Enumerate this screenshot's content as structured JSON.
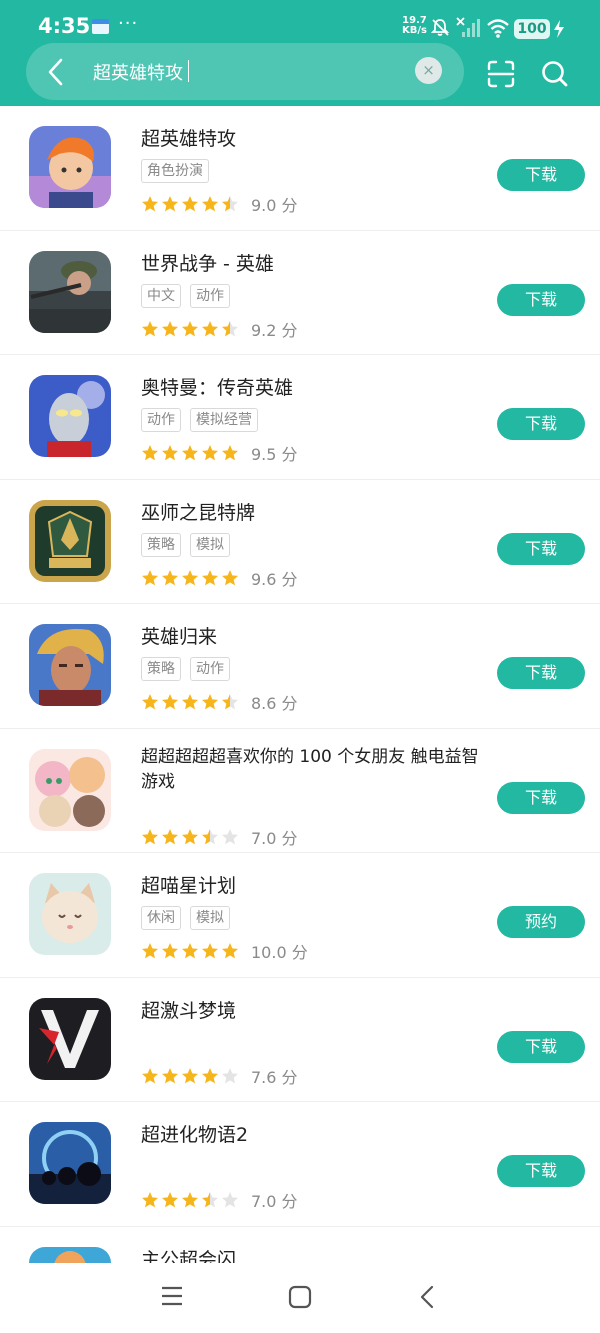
{
  "status_bar": {
    "time": "4:35",
    "net_speed_value": "19.7",
    "net_speed_unit": "KB/s",
    "battery": "100",
    "icons": [
      "app-card-icon",
      "more-dots-icon",
      "mute-icon",
      "no-signal-icon",
      "wifi-icon",
      "battery-icon",
      "charging-icon"
    ]
  },
  "search": {
    "query": "超英雄特攻",
    "clear_symbol": "×",
    "icons": [
      "back-arrow-icon",
      "clear-icon",
      "scan-icon",
      "search-icon"
    ]
  },
  "colors": {
    "brand": "#22b8a1",
    "star": "#f7b51c",
    "star_empty": "#e4e4e4"
  },
  "results": [
    {
      "title": "超英雄特攻",
      "tags": [
        "角色扮演"
      ],
      "rating": 4.5,
      "score": "9.0 分",
      "action": "下载"
    },
    {
      "title": "世界战争 - 英雄",
      "tags": [
        "中文",
        "动作"
      ],
      "rating": 4.5,
      "score": "9.2 分",
      "action": "下载"
    },
    {
      "title": "奥特曼：传奇英雄",
      "tags": [
        "动作",
        "模拟经营"
      ],
      "rating": 5,
      "score": "9.5 分",
      "action": "下载"
    },
    {
      "title": "巫师之昆特牌",
      "tags": [
        "策略",
        "模拟"
      ],
      "rating": 5,
      "score": "9.6 分",
      "action": "下载"
    },
    {
      "title": "英雄归来",
      "tags": [
        "策略",
        "动作"
      ],
      "rating": 4.5,
      "score": "8.6 分",
      "action": "下载"
    },
    {
      "title": "超超超超超喜欢你的 100 个女朋友 触电益智游戏",
      "tags": [],
      "rating": 3.5,
      "score": "7.0 分",
      "action": "下载"
    },
    {
      "title": "超喵星计划",
      "tags": [
        "休闲",
        "模拟"
      ],
      "rating": 5,
      "score": "10.0 分",
      "action": "预约"
    },
    {
      "title": "超激斗梦境",
      "tags": [],
      "rating": 4,
      "score": "7.6 分",
      "action": "下载"
    },
    {
      "title": "超进化物语2",
      "tags": [],
      "rating": 3.5,
      "score": "7.0 分",
      "action": "下载"
    },
    {
      "title": "主公超会闪",
      "tags": [],
      "rating": 0,
      "score": "",
      "action": ""
    }
  ],
  "nav_bar": {
    "icons": [
      "menu-icon",
      "home-icon",
      "back-icon"
    ]
  }
}
